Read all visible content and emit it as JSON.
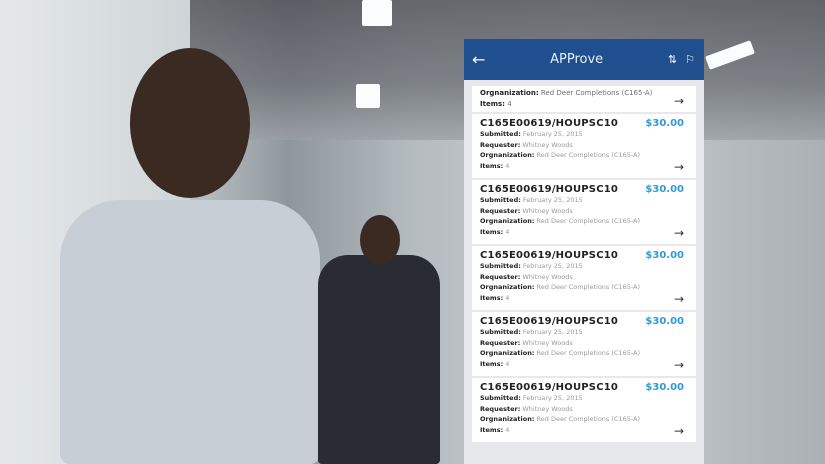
{
  "app": {
    "title": "APProve",
    "back_icon": "arrow-left-icon",
    "sort_icon": "sort-icon",
    "flag_icon": "flag-icon"
  },
  "labels": {
    "submitted": "Submitted:",
    "requester": "Requester:",
    "organization": "Orgnanization:",
    "items": "Items:"
  },
  "partial": {
    "organization": "Red Deer Completions (C165-A)",
    "items": "4"
  },
  "requests": [
    {
      "id": "C165E00619/HOUPSC10",
      "amount": "$30.00",
      "submitted": "February 25, 2015",
      "requester": "Whitney Woods",
      "organization": "Red Deer Completions (C165-A)",
      "items": "4"
    },
    {
      "id": "C165E00619/HOUPSC10",
      "amount": "$30.00",
      "submitted": "February 25, 2015",
      "requester": "Whitney Woods",
      "organization": "Red Deer Completions (C165-A)",
      "items": "4"
    },
    {
      "id": "C165E00619/HOUPSC10",
      "amount": "$30.00",
      "submitted": "February 25, 2015",
      "requester": "Whitney Woods",
      "organization": "Red Deer Completions (C165-A)",
      "items": "4"
    },
    {
      "id": "C165E00619/HOUPSC10",
      "amount": "$30.00",
      "submitted": "February 25, 2015",
      "requester": "Whitney Woods",
      "organization": "Red Deer Completions (C165-A)",
      "items": "4"
    },
    {
      "id": "C165E00619/HOUPSC10",
      "amount": "$30.00",
      "submitted": "February 25, 2015",
      "requester": "Whitney Woods",
      "organization": "Red Deer Completions (C165-A)",
      "items": "4"
    }
  ]
}
